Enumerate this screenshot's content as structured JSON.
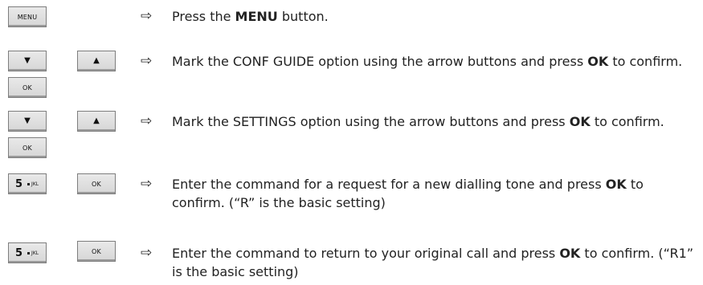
{
  "keys": {
    "menu": "MENU",
    "down": "▼",
    "up": "▲",
    "ok": "OK",
    "five_digit": "5",
    "five_letters": "JKL"
  },
  "arrow_glyph": "⇨",
  "steps": [
    {
      "pre": "Press the ",
      "bold": "MENU",
      "post": " button."
    },
    {
      "pre": "Mark the CONF GUIDE option using the arrow buttons and press ",
      "bold": "OK",
      "post": " to confirm."
    },
    {
      "pre": "Mark the SETTINGS option using the arrow buttons and press ",
      "bold": "OK",
      "post": " to confirm."
    },
    {
      "pre": "Enter the command for a request for a new dialling tone and press ",
      "bold": "OK",
      "post": " to confirm. (“R” is the basic setting)"
    },
    {
      "pre": "Enter the command to return to your original call and press ",
      "bold": "OK",
      "post": " to confirm. (“R1” is the basic setting)"
    }
  ]
}
